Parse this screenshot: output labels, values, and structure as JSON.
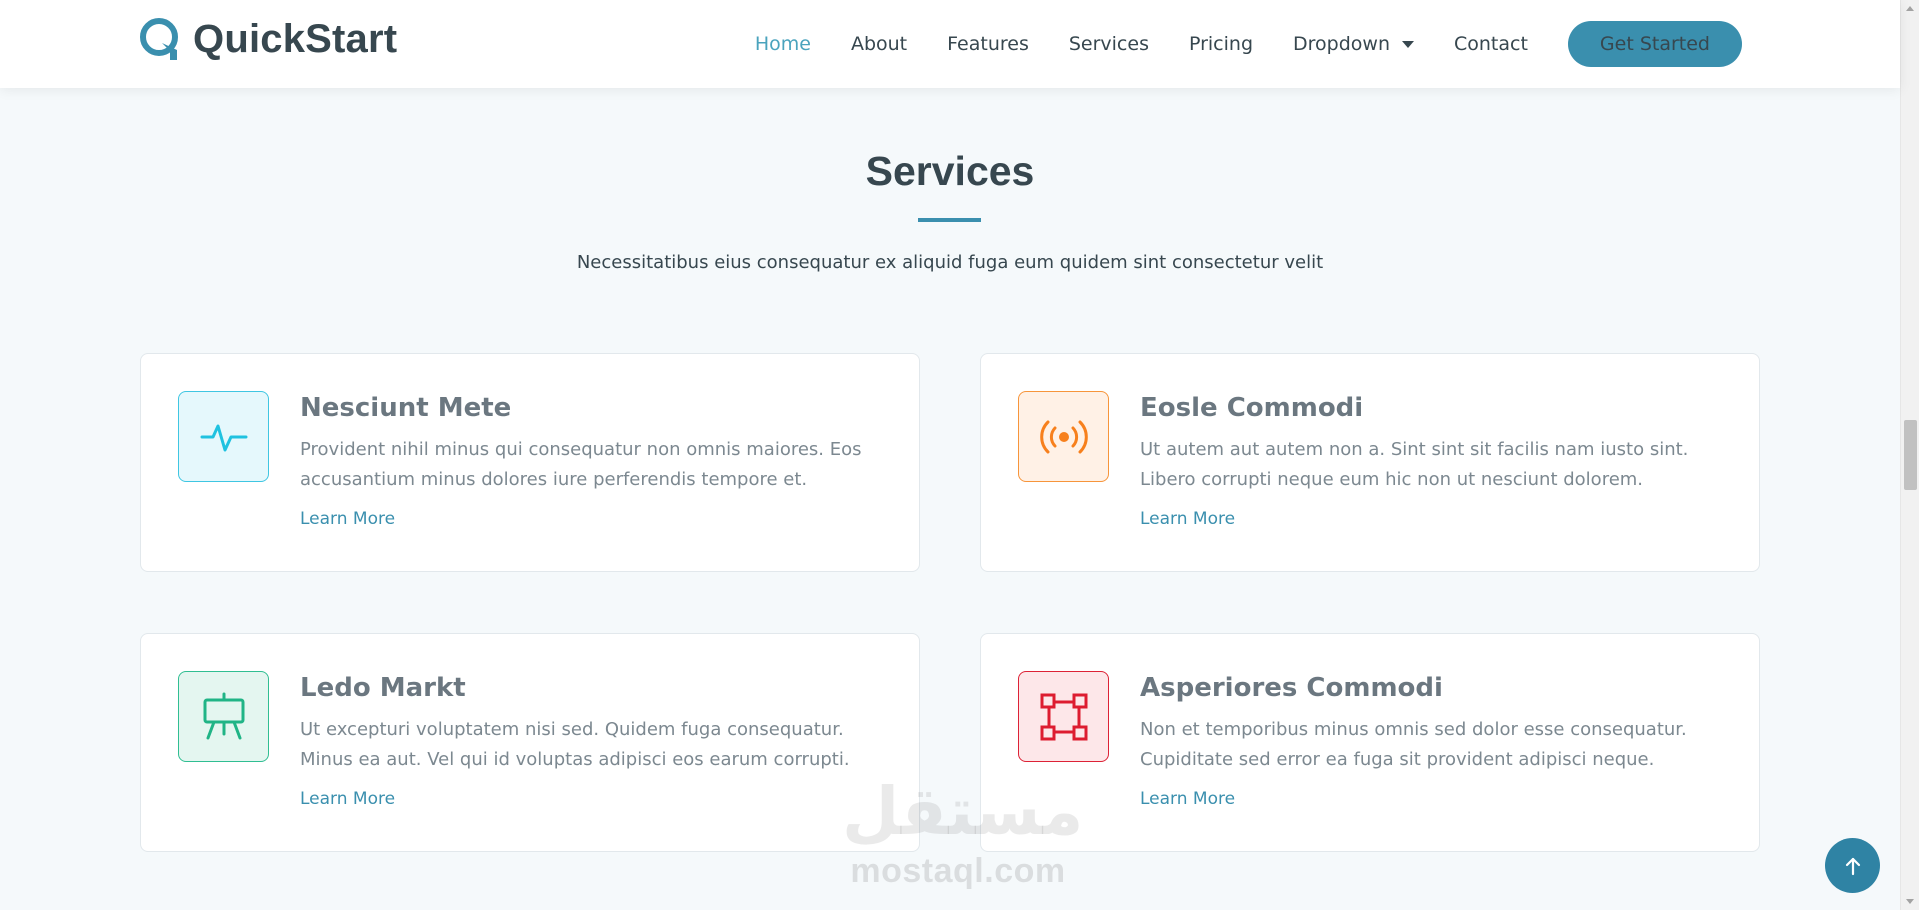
{
  "brand": {
    "name": "QuickStart",
    "accent": "#3a8fae"
  },
  "nav": {
    "items": [
      {
        "label": "Home",
        "active": true
      },
      {
        "label": "About"
      },
      {
        "label": "Features"
      },
      {
        "label": "Services"
      },
      {
        "label": "Pricing"
      },
      {
        "label": "Dropdown",
        "has_menu": true
      },
      {
        "label": "Contact"
      }
    ],
    "cta": "Get Started"
  },
  "section": {
    "title": "Services",
    "subtitle": "Necessitatibus eius consequatur ex aliquid fuga eum quidem sint consectetur velit"
  },
  "services": [
    {
      "title": "Nesciunt Mete",
      "description": "Provident nihil minus qui consequatur non omnis maiores. Eos accusantium minus dolores iure perferendis tempore et.",
      "link": "Learn More",
      "icon": "activity-icon",
      "color": "#1fc2e0"
    },
    {
      "title": "Eosle Commodi",
      "description": "Ut autem aut autem non a. Sint sint sit facilis nam iusto sint. Libero corrupti neque eum hic non ut nesciunt dolorem.",
      "link": "Learn More",
      "icon": "broadcast-icon",
      "color": "#f7801d"
    },
    {
      "title": "Ledo Markt",
      "description": "Ut excepturi voluptatem nisi sed. Quidem fuga consequatur. Minus ea aut. Vel qui id voluptas adipisci eos earum corrupti.",
      "link": "Learn More",
      "icon": "easel-icon",
      "color": "#20b486"
    },
    {
      "title": "Asperiores Commodi",
      "description": "Non et temporibus minus omnis sed dolor esse consequatur. Cupiditate sed error ea fuga sit provident adipisci neque.",
      "link": "Learn More",
      "icon": "bounding-box-icon",
      "color": "#dd1c30"
    }
  ],
  "watermark": {
    "arabic": "مستقل",
    "latin": "mostaql.com"
  },
  "back_to_top": {
    "icon": "arrow-up-icon"
  }
}
